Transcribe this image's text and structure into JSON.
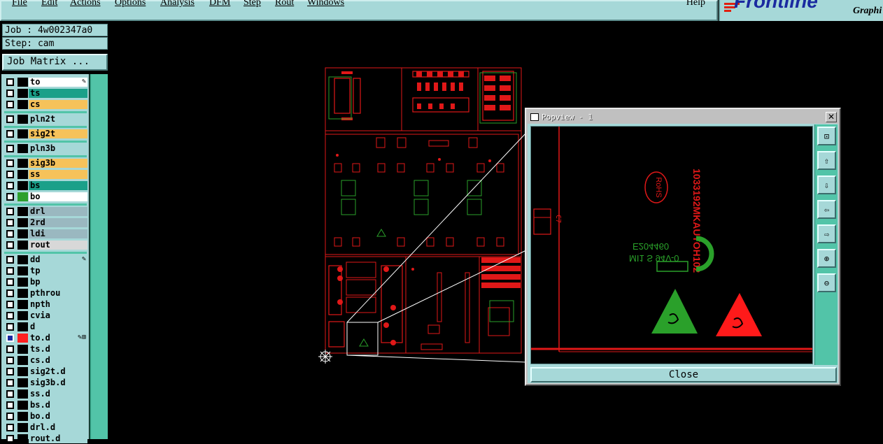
{
  "menubar": {
    "items": [
      {
        "id": "file",
        "label": "File"
      },
      {
        "id": "edit",
        "label": "Edit"
      },
      {
        "id": "actions",
        "label": "Actions"
      },
      {
        "id": "options",
        "label": "Options"
      },
      {
        "id": "analysis",
        "label": "Analysis"
      },
      {
        "id": "dfm",
        "label": "DFM"
      },
      {
        "id": "step",
        "label": "Step"
      },
      {
        "id": "rout",
        "label": "Rout"
      },
      {
        "id": "windows",
        "label": "Windows"
      }
    ],
    "help": "Help"
  },
  "logo": {
    "text": "Frontline",
    "sub": "Graphi"
  },
  "job": {
    "label": "Job : 4w002347a0"
  },
  "step": {
    "label": "Step: cam"
  },
  "job_matrix": {
    "label": "Job Matrix ..."
  },
  "layers": [
    {
      "name": "to",
      "color": "wh",
      "mark": "✎"
    },
    {
      "name": "ts",
      "color": "tl"
    },
    {
      "name": "cs",
      "color": "or"
    },
    {
      "name": "pln2t",
      "color": "gb"
    },
    {
      "name": "sig2t",
      "color": "or"
    },
    {
      "name": "pln3b",
      "color": "gb"
    },
    {
      "name": "sig3b",
      "color": "or"
    },
    {
      "name": "ss",
      "color": "or"
    },
    {
      "name": "bs",
      "color": "tl"
    },
    {
      "name": "bo",
      "color": "wh",
      "swatch": "#2ea02e"
    },
    {
      "name": "drl",
      "color": "gr"
    },
    {
      "name": "2rd",
      "color": "gr"
    },
    {
      "name": "ldi",
      "color": "gr"
    },
    {
      "name": "rout",
      "color": "lg"
    },
    {
      "name": "dd",
      "color": "gb",
      "mark": "✎"
    },
    {
      "name": "tp",
      "color": "gb"
    },
    {
      "name": "bp",
      "color": "gb"
    },
    {
      "name": "pthrou",
      "color": "gb"
    },
    {
      "name": "npth",
      "color": "gb"
    },
    {
      "name": "cvia",
      "color": "gb"
    },
    {
      "name": "d",
      "color": "gb"
    },
    {
      "name": "to.d",
      "color": "gb",
      "swatch": "#ff2020",
      "checked": true,
      "mark": "✎⊞"
    },
    {
      "name": "ts.d",
      "color": "gb"
    },
    {
      "name": "cs.d",
      "color": "gb"
    },
    {
      "name": "sig2t.d",
      "color": "gb"
    },
    {
      "name": "sig3b.d",
      "color": "gb"
    },
    {
      "name": "ss.d",
      "color": "gb"
    },
    {
      "name": "bs.d",
      "color": "gb"
    },
    {
      "name": "bo.d",
      "color": "gb"
    },
    {
      "name": "drl.d",
      "color": "gb"
    },
    {
      "name": "rout.d",
      "color": "gb"
    }
  ],
  "popview": {
    "title": "Popview - 1",
    "close_x": "✕",
    "close_label": "Close",
    "tools": [
      {
        "icon": "zoom-window-icon",
        "glyph": "⊡"
      },
      {
        "icon": "pan-up-icon",
        "glyph": "⇧"
      },
      {
        "icon": "pan-down-icon",
        "glyph": "⇩"
      },
      {
        "icon": "pan-left-icon",
        "glyph": "⇦"
      },
      {
        "icon": "pan-right-icon",
        "glyph": "⇨"
      },
      {
        "icon": "zoom-in-icon",
        "glyph": "⊕"
      },
      {
        "icon": "zoom-out-icon",
        "glyph": "⊖"
      }
    ],
    "marking": {
      "part_number": "1033192MKAUTOH102",
      "rohs": "RoHS",
      "ul_number": "E204460",
      "ul_grade": "MI1 S 94V-0"
    }
  },
  "colors": {
    "panel": "#a6d8d8",
    "teal": "#52c4a8",
    "trace": "#e01818",
    "silk": "#2aa02a"
  }
}
